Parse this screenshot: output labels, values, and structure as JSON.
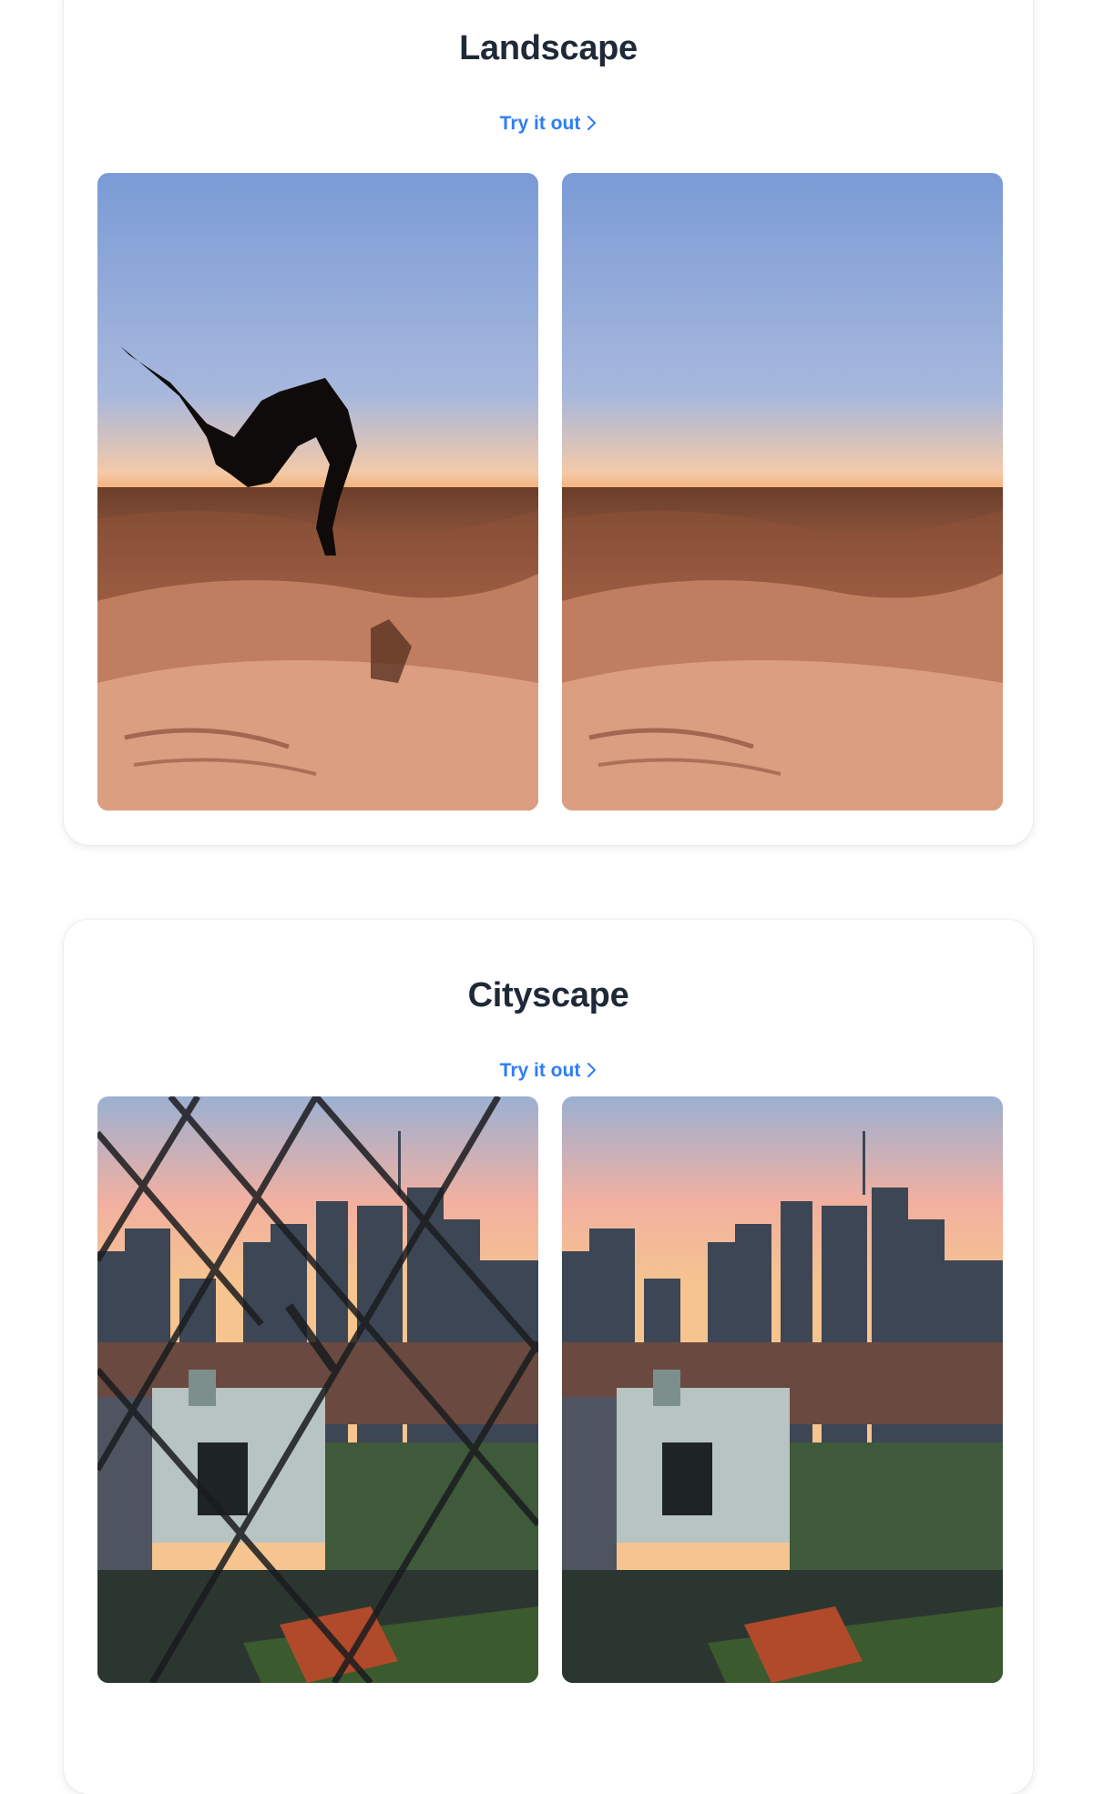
{
  "sections": [
    {
      "title": "Landscape",
      "cta_label": "Try it out",
      "images": [
        {
          "alt": "Person backflipping over desert dunes at sunset"
        },
        {
          "alt": "Desert dunes at sunset with person removed"
        }
      ]
    },
    {
      "title": "Cityscape",
      "cta_label": "Try it out",
      "images": [
        {
          "alt": "City skyline at sunset viewed through a chain-link fence"
        },
        {
          "alt": "City skyline at sunset with fence removed"
        }
      ]
    }
  ],
  "colors": {
    "title": "#1f2937",
    "link": "#2f7df6"
  },
  "icons": {
    "link_chevron": "chevron-right-icon"
  }
}
